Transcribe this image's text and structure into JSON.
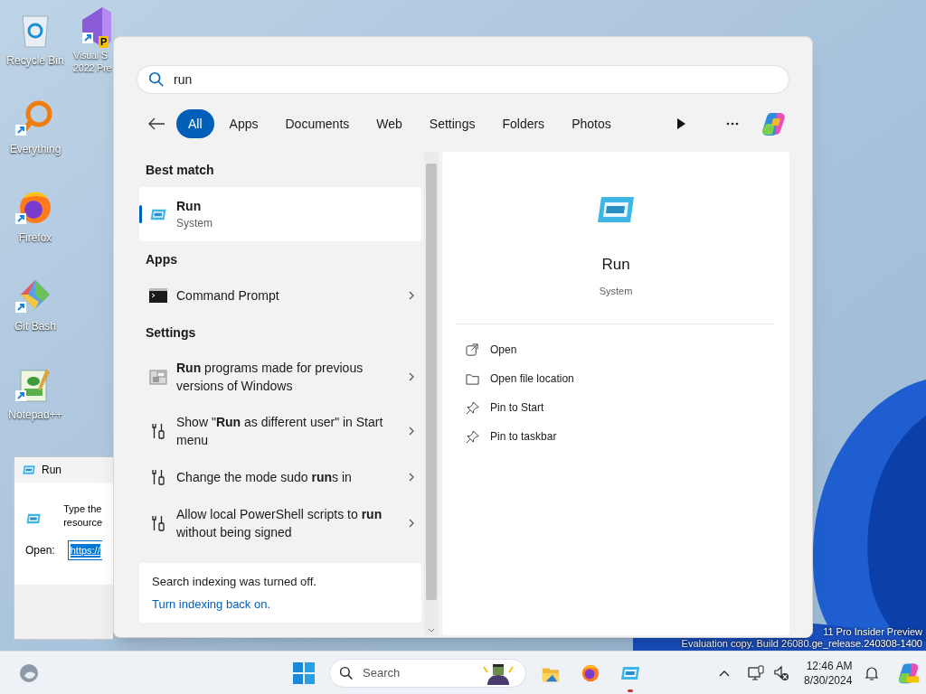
{
  "desktop": {
    "icons": [
      {
        "label": "Recycle Bin",
        "kind": "recycle",
        "shortcut": false
      },
      {
        "label": "Everything",
        "kind": "everything",
        "shortcut": true
      },
      {
        "label": "Firefox",
        "kind": "firefox",
        "shortcut": true
      },
      {
        "label": "Git Bash",
        "kind": "git",
        "shortcut": true
      },
      {
        "label": "Notepad++",
        "kind": "notepad",
        "shortcut": true
      }
    ],
    "partial_icon": {
      "lines": [
        "Visual S",
        "2022 Pre"
      ],
      "badge": "P",
      "shortcut": true
    },
    "watermark": [
      "11 Pro Insider Preview",
      "Evaluation copy. Build 26080.ge_release.240308-1400"
    ]
  },
  "run_dialog": {
    "title": "Run",
    "prompt_lines": [
      "Type the",
      "resource"
    ],
    "open_label": "Open:",
    "value": "https://"
  },
  "search": {
    "query": "run",
    "filters": [
      {
        "label": "All",
        "selected": true
      },
      {
        "label": "Apps",
        "selected": false
      },
      {
        "label": "Documents",
        "selected": false
      },
      {
        "label": "Web",
        "selected": false
      },
      {
        "label": "Settings",
        "selected": false
      },
      {
        "label": "Folders",
        "selected": false
      },
      {
        "label": "Photos",
        "selected": false
      }
    ],
    "sections": [
      {
        "title": "Best match",
        "items": [
          {
            "kind": "run",
            "text": "Run",
            "subtitle": "System",
            "selected": true
          }
        ]
      },
      {
        "title": "Apps",
        "items": [
          {
            "kind": "cmd",
            "text": "Command Prompt",
            "selected": false
          }
        ]
      },
      {
        "title": "Settings",
        "items": [
          {
            "kind": "compat",
            "text": "**Run** programs made for previous versions of Windows",
            "selected": false
          },
          {
            "kind": "settings",
            "text": "Show \"**Run** as different user\" in Start menu",
            "selected": false
          },
          {
            "kind": "settings",
            "text": "Change the mode sudo **run**s in",
            "selected": false
          },
          {
            "kind": "settings",
            "text": "Allow local PowerShell scripts to **run** without being signed",
            "selected": false
          }
        ]
      }
    ],
    "footer": {
      "text": "Search indexing was turned off.",
      "link": "Turn indexing back on."
    },
    "details": {
      "title": "Run",
      "subtitle": "System",
      "actions": [
        {
          "kind": "open",
          "label": "Open"
        },
        {
          "kind": "folder",
          "label": "Open file location"
        },
        {
          "kind": "pin",
          "label": "Pin to Start"
        },
        {
          "kind": "pin",
          "label": "Pin to taskbar"
        }
      ]
    }
  },
  "taskbar": {
    "search_placeholder": "Search",
    "apps": [
      {
        "kind": "explorer",
        "running": false
      },
      {
        "kind": "firefox",
        "running": false
      },
      {
        "kind": "run",
        "running": true
      }
    ],
    "time": "12:46 AM",
    "date": "8/30/2024"
  }
}
